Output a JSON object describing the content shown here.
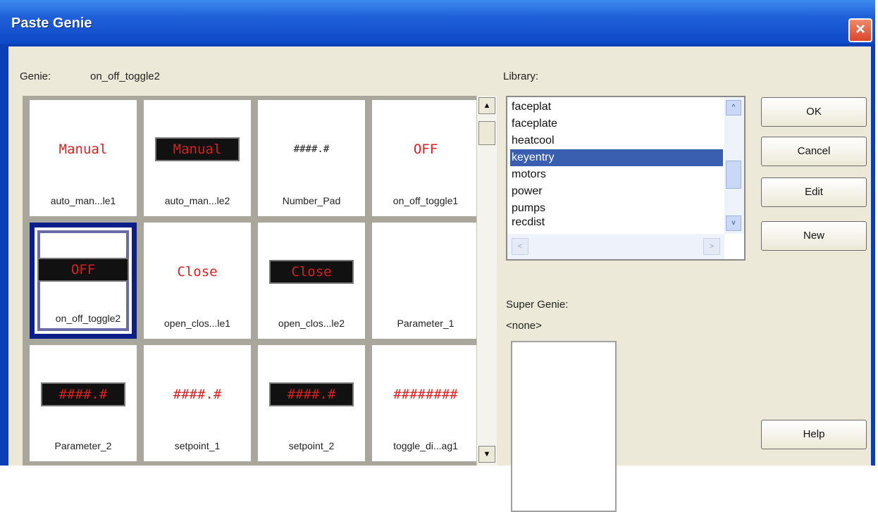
{
  "window": {
    "title": "Paste Genie",
    "close_glyph": "×"
  },
  "genie": {
    "label": "Genie:",
    "value": "on_off_toggle2",
    "items": [
      {
        "caption": "auto_man...le1",
        "preview": "Manual",
        "style": "plain"
      },
      {
        "caption": "auto_man...le2",
        "preview": "Manual",
        "style": "dark"
      },
      {
        "caption": "Number_Pad",
        "preview": "####.#",
        "style": "num"
      },
      {
        "caption": "on_off_toggle1",
        "preview": "OFF",
        "style": "plain"
      },
      {
        "caption": "on_off_toggle2",
        "preview": "OFF",
        "style": "dark",
        "selected": true
      },
      {
        "caption": "open_clos...le1",
        "preview": "Close",
        "style": "plain"
      },
      {
        "caption": "open_clos...le2",
        "preview": "Close",
        "style": "dark"
      },
      {
        "caption": "Parameter_1",
        "preview": "",
        "style": "plain"
      },
      {
        "caption": "Parameter_2",
        "preview": "####.#",
        "style": "dark"
      },
      {
        "caption": "setpoint_1",
        "preview": "####.#",
        "style": "plain"
      },
      {
        "caption": "setpoint_2",
        "preview": "####.#",
        "style": "dark"
      },
      {
        "caption": "toggle_di...ag1",
        "preview": "########",
        "style": "plain"
      }
    ]
  },
  "library": {
    "label": "Library:",
    "items": [
      "faceplat",
      "faceplate",
      "heatcool",
      "keyentry",
      "motors",
      "power",
      "pumps",
      "recdist"
    ],
    "selected": "keyentry"
  },
  "super_genie": {
    "label": "Super Genie:",
    "value": "<none>"
  },
  "buttons": {
    "ok": "OK",
    "cancel": "Cancel",
    "edit": "Edit",
    "new": "New",
    "help": "Help"
  },
  "scroll": {
    "up_icon": "▲",
    "down_icon": "▼",
    "left_icon": "<",
    "right_icon": ">",
    "small_up_icon": "^",
    "small_down_icon": "v"
  },
  "colors": {
    "title_bar": "#1e5fd8",
    "selection": "#3a5fb0",
    "selected_tile_border": "#0b1e8a",
    "preview_red": "#e02020"
  }
}
